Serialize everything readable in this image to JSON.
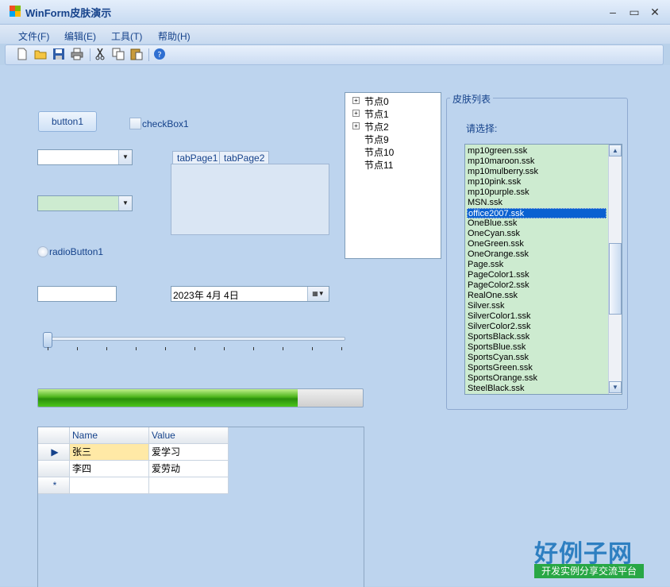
{
  "window": {
    "title": "WinForm皮肤演示",
    "minimize": "‒",
    "maximize": "▭",
    "close": "✕"
  },
  "menu": [
    "文件(F)",
    "编辑(E)",
    "工具(T)",
    "帮助(H)"
  ],
  "toolbar": [
    "new-icon",
    "open-icon",
    "save-icon",
    "print-icon",
    "cut-icon",
    "copy-icon",
    "paste-icon",
    "help-icon"
  ],
  "controls": {
    "button1": "button1",
    "checkbox1": "checkBox1",
    "radio1": "radioButton1",
    "tab1": "tabPage1",
    "tab2": "tabPage2",
    "date": "2023年  4月  4日",
    "progress": 0.8
  },
  "grid": {
    "headers": [
      "Name",
      "Value"
    ],
    "rows": [
      [
        "张三",
        "爱学习"
      ],
      [
        "李四",
        "爱劳动"
      ]
    ]
  },
  "tree": [
    "节点0",
    "节点1",
    "节点2",
    "节点9",
    "节点10",
    "节点11"
  ],
  "skins": {
    "group_title": "皮肤列表",
    "prompt": "请选择:",
    "selected": "office2007.ssk",
    "items": [
      "mp10green.ssk",
      "mp10maroon.ssk",
      "mp10mulberry.ssk",
      "mp10pink.ssk",
      "mp10purple.ssk",
      "MSN.ssk",
      "office2007.ssk",
      "OneBlue.ssk",
      "OneCyan.ssk",
      "OneGreen.ssk",
      "OneOrange.ssk",
      "Page.ssk",
      "PageColor1.ssk",
      "PageColor2.ssk",
      "RealOne.ssk",
      "Silver.ssk",
      "SilverColor1.ssk",
      "SilverColor2.ssk",
      "SportsBlack.ssk",
      "SportsBlue.ssk",
      "SportsCyan.ssk",
      "SportsGreen.ssk",
      "SportsOrange.ssk",
      "SteelBlack.ssk"
    ]
  },
  "logo": {
    "title": "好例子网",
    "tagline": "开发实例分享交流平台"
  }
}
